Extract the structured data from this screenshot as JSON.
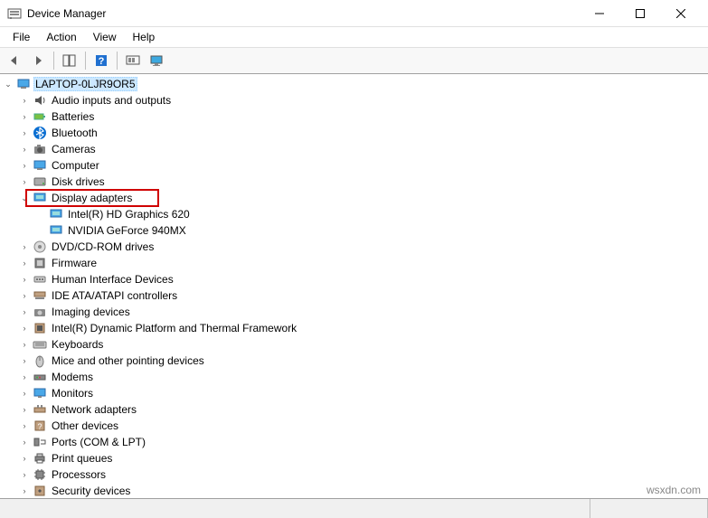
{
  "window": {
    "title": "Device Manager"
  },
  "menubar": {
    "file": "File",
    "action": "Action",
    "view": "View",
    "help": "Help"
  },
  "tree": {
    "root": "LAPTOP-0LJR9OR5",
    "audio": "Audio inputs and outputs",
    "batteries": "Batteries",
    "bluetooth": "Bluetooth",
    "cameras": "Cameras",
    "computer": "Computer",
    "disk": "Disk drives",
    "display": "Display adapters",
    "display_intel": "Intel(R) HD Graphics 620",
    "display_nvidia": "NVIDIA GeForce 940MX",
    "dvd": "DVD/CD-ROM drives",
    "firmware": "Firmware",
    "hid": "Human Interface Devices",
    "ide": "IDE ATA/ATAPI controllers",
    "imaging": "Imaging devices",
    "thermal": "Intel(R) Dynamic Platform and Thermal Framework",
    "keyboards": "Keyboards",
    "mice": "Mice and other pointing devices",
    "modems": "Modems",
    "monitors": "Monitors",
    "network": "Network adapters",
    "other": "Other devices",
    "ports": "Ports (COM & LPT)",
    "printq": "Print queues",
    "processors": "Processors",
    "security": "Security devices"
  },
  "watermark": "wsxdn.com"
}
